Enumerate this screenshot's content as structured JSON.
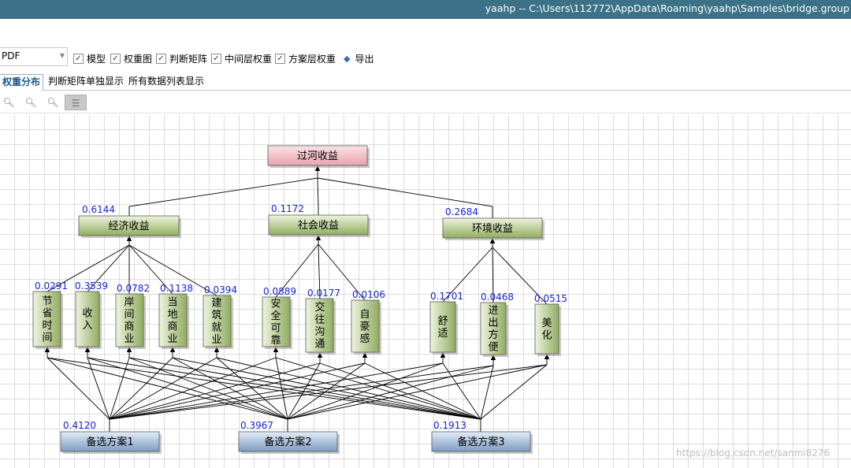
{
  "window": {
    "title": "yaahp -- C:\\Users\\112772\\AppData\\Roaming\\yaahp\\Samples\\bridge.group"
  },
  "toolbar": {
    "format_select": "PDF",
    "checkboxes": [
      {
        "label": "模型",
        "checked": true
      },
      {
        "label": "权重图",
        "checked": true
      },
      {
        "label": "判断矩阵",
        "checked": true
      },
      {
        "label": "中间层权重",
        "checked": true
      },
      {
        "label": "方案层权重",
        "checked": true
      }
    ],
    "export_label": "导出"
  },
  "tabs": [
    {
      "label": "权重分布",
      "active": true
    },
    {
      "label": "判断矩阵单独显示",
      "active": false
    },
    {
      "label": "所有数据列表显示",
      "active": false
    }
  ],
  "tools": [
    {
      "icon": "zoom-in-icon",
      "glyph": "🔍︎",
      "pressed": false
    },
    {
      "icon": "zoom-out-icon",
      "glyph": "🔍︎",
      "pressed": false
    },
    {
      "icon": "zoom-fit-icon",
      "glyph": "🔍︎",
      "pressed": false
    },
    {
      "icon": "list-view-icon",
      "glyph": "☰",
      "pressed": true
    }
  ],
  "diagram": {
    "goal": {
      "label": "过河收益"
    },
    "criteria": [
      {
        "label": "经济收益",
        "weight": "0.6144"
      },
      {
        "label": "社会收益",
        "weight": "0.1172"
      },
      {
        "label": "环境收益",
        "weight": "0.2684"
      }
    ],
    "subcriteria": [
      {
        "label": "节省时间",
        "weight": "0.0291",
        "parent": 0
      },
      {
        "label": "收入",
        "weight": "0.3539",
        "parent": 0
      },
      {
        "label": "岸间商业",
        "weight": "0.0782",
        "parent": 0
      },
      {
        "label": "当地商业",
        "weight": "0.1138",
        "parent": 0
      },
      {
        "label": "建筑就业",
        "weight": "0.0394",
        "parent": 0
      },
      {
        "label": "安全可靠",
        "weight": "0.0889",
        "parent": 1
      },
      {
        "label": "交往沟通",
        "weight": "0.0177",
        "parent": 1
      },
      {
        "label": "自豪感",
        "weight": "0.0106",
        "parent": 1
      },
      {
        "label": "舒适",
        "weight": "0.1701",
        "parent": 2
      },
      {
        "label": "进出方便",
        "weight": "0.0468",
        "parent": 2
      },
      {
        "label": "美化",
        "weight": "0.0515",
        "parent": 2
      }
    ],
    "alternatives": [
      {
        "label": "备选方案1",
        "weight": "0.4120"
      },
      {
        "label": "备选方案2",
        "weight": "0.3967"
      },
      {
        "label": "备选方案3",
        "weight": "0.1913"
      }
    ],
    "colors": {
      "goal_fill_top": "#fbe3e6",
      "goal_fill_bottom": "#e7a3ab",
      "criteria_fill_top": "#eef4de",
      "criteria_fill_bottom": "#91ad60",
      "alt_fill_top": "#e4ecf6",
      "alt_fill_bottom": "#7d9cc3",
      "weight_text": "#1a24d8",
      "line": "#000000"
    }
  },
  "watermark": "https://blog.csdn.net/sanmi8276"
}
